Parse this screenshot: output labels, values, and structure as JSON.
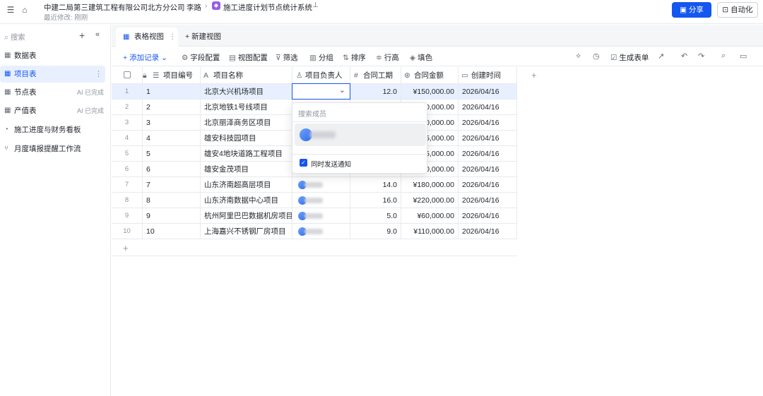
{
  "header": {
    "org": "中建二局第三建筑工程有限公司北方分公司",
    "user": "李路",
    "app_title": "施工进度计划节点统计系统",
    "last_modified": "最近修改: 刚刚",
    "share_label": "分享",
    "automation_label": "自动化"
  },
  "sidebar": {
    "search_placeholder": "搜索",
    "items": [
      {
        "label": "数据表",
        "icon": "table-icon",
        "badge": "",
        "active": false
      },
      {
        "label": "项目表",
        "icon": "table-icon",
        "badge": "",
        "active": true
      },
      {
        "label": "节点表",
        "icon": "table-icon",
        "badge": "AI 已完成",
        "active": false
      },
      {
        "label": "产值表",
        "icon": "table-icon",
        "badge": "AI 已完成",
        "active": false
      },
      {
        "label": "施工进度与财务看板",
        "icon": "dashboard-icon",
        "badge": "",
        "active": false
      },
      {
        "label": "月度填报提醒工作流",
        "icon": "workflow-icon",
        "badge": "",
        "active": false
      }
    ]
  },
  "tabs": {
    "active": "表格视图",
    "new": "新建视图"
  },
  "toolbar": {
    "add_record": "添加记录",
    "field_config": "字段配置",
    "view_config": "视图配置",
    "filter": "筛选",
    "group": "分组",
    "sort": "排序",
    "row_height": "行高",
    "fill_color": "填色",
    "generate_form": "生成表单"
  },
  "table": {
    "columns": [
      "项目编号",
      "项目名称",
      "项目负责人",
      "合同工期",
      "合同金额",
      "创建时间"
    ],
    "rows": [
      {
        "rn": "1",
        "id": "1",
        "name": "北京大兴机场项目",
        "period": "12.0",
        "amount": "¥150,000.00",
        "created": "2026/04/16"
      },
      {
        "rn": "2",
        "id": "2",
        "name": "北京地铁1号线项目",
        "period": "",
        "amount": "0,000.00",
        "created": "2026/04/16"
      },
      {
        "rn": "3",
        "id": "3",
        "name": "北京丽泽商务区项目",
        "period": "",
        "amount": "0,000.00",
        "created": "2026/04/16"
      },
      {
        "rn": "4",
        "id": "4",
        "name": "雄安科技园项目",
        "period": "",
        "amount": "5,000.00",
        "created": "2026/04/16"
      },
      {
        "rn": "5",
        "id": "5",
        "name": "雄安4地块道路工程项目",
        "period": "",
        "amount": "5,000.00",
        "created": "2026/04/16"
      },
      {
        "rn": "6",
        "id": "6",
        "name": "雄安金茂项目",
        "period": "",
        "amount": "0,000.00",
        "created": "2026/04/16"
      },
      {
        "rn": "7",
        "id": "7",
        "name": "山东济南超高层项目",
        "period": "14.0",
        "amount": "¥180,000.00",
        "created": "2026/04/16"
      },
      {
        "rn": "8",
        "id": "8",
        "name": "山东济南数据中心项目",
        "period": "16.0",
        "amount": "¥220,000.00",
        "created": "2026/04/16"
      },
      {
        "rn": "9",
        "id": "9",
        "name": "杭州阿里巴巴数据机房项目",
        "period": "5.0",
        "amount": "¥60,000.00",
        "created": "2026/04/16"
      },
      {
        "rn": "10",
        "id": "10",
        "name": "上海嘉兴不锈钢厂房项目",
        "period": "9.0",
        "amount": "¥110,000.00",
        "created": "2026/04/16"
      }
    ]
  },
  "member_popup": {
    "search_placeholder": "搜索成员",
    "notify_label": "同时发送通知",
    "notify_checked": true
  },
  "colors": {
    "accent": "#1456f0",
    "selected_row": "#e8f0ff"
  }
}
